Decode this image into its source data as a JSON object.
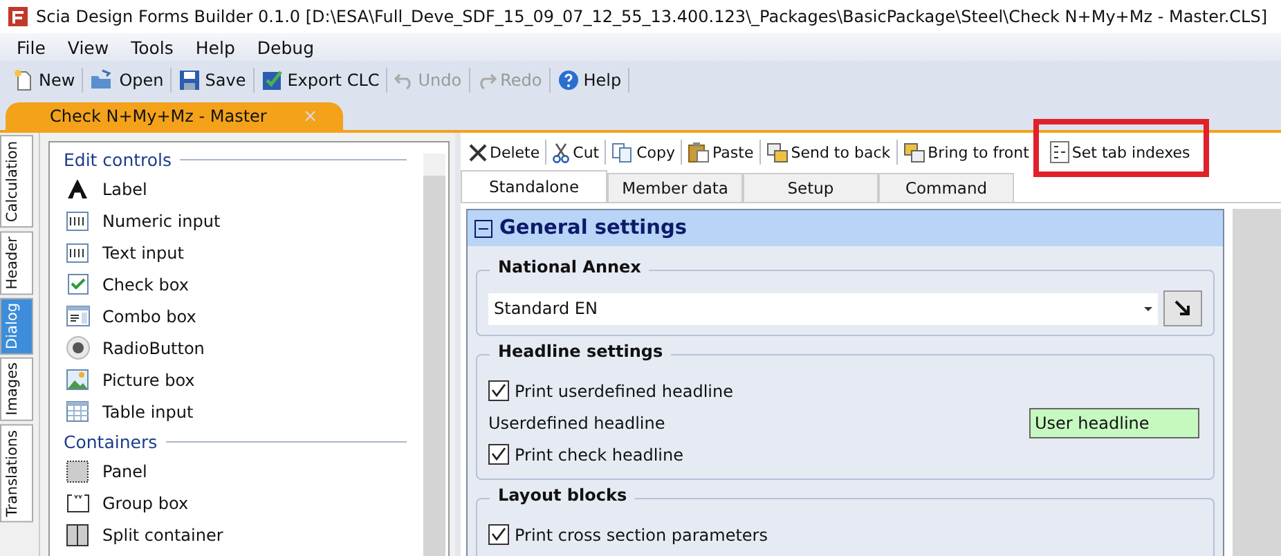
{
  "window": {
    "title": "Scia Design Forms Builder 0.1.0 [D:\\ESA\\Full_Deve_SDF_15_09_07_12_55_13.400.123\\_Packages\\BasicPackage\\Steel\\Check N+My+Mz - Master.CLS]"
  },
  "menu": [
    "File",
    "View",
    "Tools",
    "Help",
    "Debug"
  ],
  "toolbar": [
    {
      "kind": "new",
      "label": "New",
      "disabled": false
    },
    {
      "kind": "open",
      "label": "Open",
      "disabled": false
    },
    {
      "kind": "save",
      "label": "Save",
      "disabled": false
    },
    {
      "kind": "export",
      "label": "Export CLC",
      "disabled": false
    },
    {
      "kind": "undo",
      "label": "Undo",
      "disabled": true
    },
    {
      "kind": "redo",
      "label": "Redo",
      "disabled": true
    },
    {
      "kind": "help",
      "label": "Help",
      "disabled": false
    }
  ],
  "document_tab": {
    "label": "Check N+My+Mz - Master",
    "close": "×"
  },
  "side_tabs": [
    {
      "label": "Calculation",
      "selected": false
    },
    {
      "label": "Header",
      "selected": false
    },
    {
      "label": "Dialog",
      "selected": true
    },
    {
      "label": "Images",
      "selected": false
    },
    {
      "label": "Translations",
      "selected": false
    }
  ],
  "toolbox": [
    {
      "title": "Edit controls",
      "items": [
        {
          "kind": "label",
          "label": "Label"
        },
        {
          "kind": "numeric",
          "label": "Numeric input"
        },
        {
          "kind": "text",
          "label": "Text input"
        },
        {
          "kind": "check",
          "label": "Check box"
        },
        {
          "kind": "combo",
          "label": "Combo box"
        },
        {
          "kind": "radio",
          "label": "RadioButton"
        },
        {
          "kind": "picture",
          "label": "Picture box"
        },
        {
          "kind": "table",
          "label": "Table input"
        }
      ]
    },
    {
      "title": "Containers",
      "items": [
        {
          "kind": "panel",
          "label": "Panel"
        },
        {
          "kind": "group",
          "label": "Group box"
        },
        {
          "kind": "split",
          "label": "Split container"
        }
      ]
    }
  ],
  "edit_toolbar": [
    {
      "kind": "delete",
      "label": "Delete"
    },
    {
      "kind": "cut",
      "label": "Cut"
    },
    {
      "kind": "copy",
      "label": "Copy"
    },
    {
      "kind": "paste",
      "label": "Paste"
    },
    {
      "kind": "back",
      "label": "Send to back"
    },
    {
      "kind": "front",
      "label": "Bring to front"
    },
    {
      "kind": "tabindex",
      "label": "Set tab indexes",
      "highlighted": true
    }
  ],
  "tabs": [
    {
      "label": "Standalone",
      "selected": true
    },
    {
      "label": "Member data",
      "selected": false
    },
    {
      "label": "Setup",
      "selected": false
    },
    {
      "label": "Command",
      "selected": false
    }
  ],
  "form": {
    "title": "General settings",
    "expanded": true,
    "groups": [
      {
        "title": "National Annex",
        "rows": [
          {
            "kind": "combo",
            "value": "Standard EN"
          }
        ]
      },
      {
        "title": "Headline settings",
        "rows": [
          {
            "kind": "check",
            "label": "Print userdefined headline",
            "checked": true
          },
          {
            "kind": "field",
            "label": "Userdefined headline",
            "value": "User headline"
          },
          {
            "kind": "check",
            "label": "Print check headline",
            "checked": true
          }
        ]
      },
      {
        "title": "Layout blocks",
        "rows": [
          {
            "kind": "check",
            "label": "Print cross section parameters",
            "checked": true
          }
        ]
      }
    ]
  }
}
